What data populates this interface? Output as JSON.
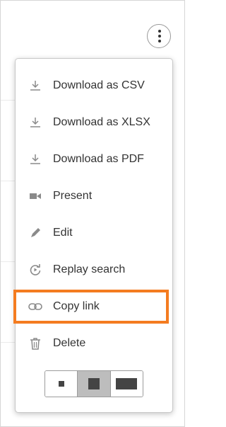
{
  "menu": {
    "items": [
      {
        "id": "download-csv",
        "label": "Download as CSV",
        "icon": "download-icon"
      },
      {
        "id": "download-xlsx",
        "label": "Download as XLSX",
        "icon": "download-icon"
      },
      {
        "id": "download-pdf",
        "label": "Download as PDF",
        "icon": "download-icon"
      },
      {
        "id": "present",
        "label": "Present",
        "icon": "video-camera-icon"
      },
      {
        "id": "edit",
        "label": "Edit",
        "icon": "pencil-icon"
      },
      {
        "id": "replay-search",
        "label": "Replay search",
        "icon": "replay-icon"
      },
      {
        "id": "copy-link",
        "label": "Copy link",
        "icon": "link-icon"
      },
      {
        "id": "delete",
        "label": "Delete",
        "icon": "trash-icon"
      }
    ],
    "size_options": [
      {
        "id": "small",
        "selected": false
      },
      {
        "id": "medium",
        "selected": true
      },
      {
        "id": "large",
        "selected": false
      }
    ]
  },
  "colors": {
    "highlight": "#f47c20",
    "icon": "#8a8a8a",
    "text": "#333333",
    "selected_size_bg": "#bdbdbd"
  }
}
